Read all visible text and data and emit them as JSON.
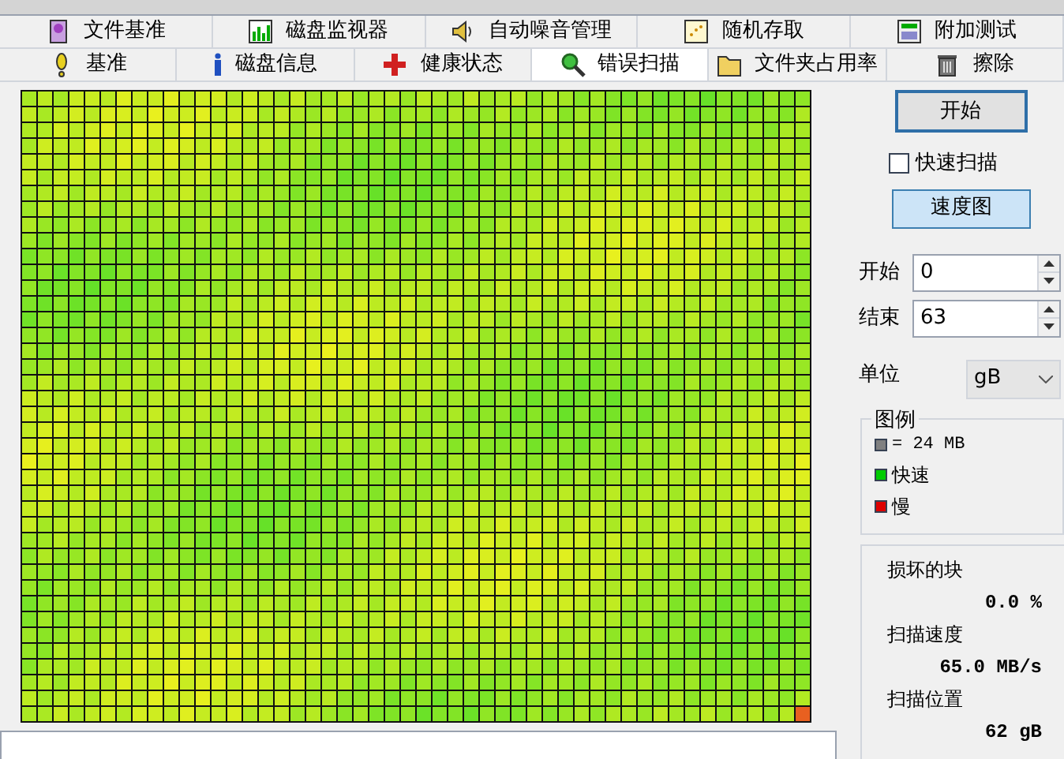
{
  "tab_rows": [
    [
      {
        "label": "文件基准",
        "selected": false
      },
      {
        "label": "磁盘监视器",
        "selected": false
      },
      {
        "label": "自动噪音管理",
        "selected": false
      },
      {
        "label": "随机存取",
        "selected": false
      },
      {
        "label": "附加测试",
        "selected": false
      }
    ],
    [
      {
        "label": "基准",
        "selected": false
      },
      {
        "label": "磁盘信息",
        "selected": false
      },
      {
        "label": "健康状态",
        "selected": false
      },
      {
        "label": "错误扫描",
        "selected": true
      },
      {
        "label": "文件夹占用率",
        "selected": false
      },
      {
        "label": "擦除",
        "selected": false
      }
    ]
  ],
  "start_button": "开始",
  "quick_scan": {
    "label": "快速扫描",
    "checked": false
  },
  "speed_map_button": "速度图",
  "range": [
    {
      "label": "开始",
      "value": "0"
    },
    {
      "label": "结束",
      "value": "63"
    }
  ],
  "unit": {
    "label": "单位",
    "value": "gB"
  },
  "legend": {
    "title": "图例",
    "items": [
      {
        "label": "= 24 MB",
        "color": "#808080"
      },
      {
        "label": "快速",
        "color": "#00cc00"
      },
      {
        "label": "慢",
        "color": "#dd0000"
      }
    ]
  },
  "stats": [
    {
      "label": "损坏的块",
      "value": "0.0 %"
    },
    {
      "label": "扫描速度",
      "value": "65.0 MB/s"
    },
    {
      "label": "扫描位置",
      "value": "62 gB"
    }
  ]
}
